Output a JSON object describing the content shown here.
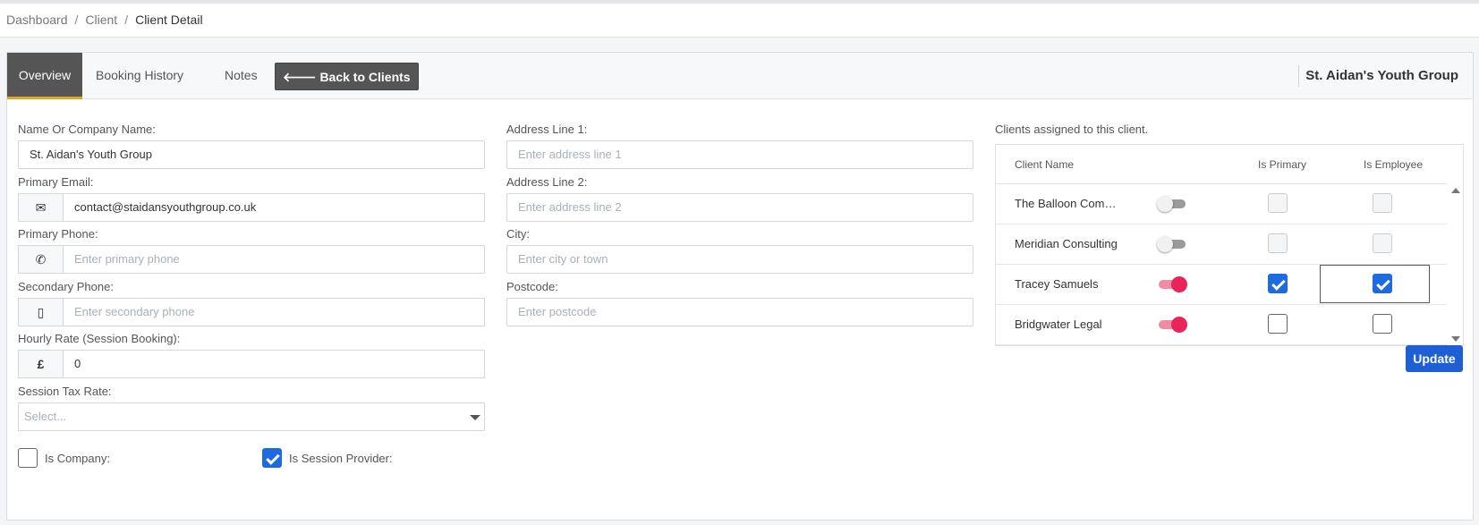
{
  "breadcrumb": {
    "items": [
      "Dashboard",
      "Client"
    ],
    "current": "Client Detail",
    "separator": "/"
  },
  "tabs": [
    {
      "label": "Overview",
      "active": true
    },
    {
      "label": "Booking History",
      "active": false
    },
    {
      "label": "Notes",
      "active": false
    }
  ],
  "back_button": {
    "icon": "arrow-left-icon",
    "label": "Back to Clients"
  },
  "client_title": "St. Aidan's Youth Group",
  "form": {
    "name": {
      "label": "Name Or Company Name:",
      "value": "St. Aidan's Youth Group"
    },
    "email": {
      "label": "Primary Email:",
      "icon": "envelope-icon",
      "value": "contact@staidansyouthgroup.co.uk"
    },
    "primary_phone": {
      "label": "Primary Phone:",
      "icon": "phone-icon",
      "placeholder": "Enter primary phone"
    },
    "secondary_phone": {
      "label": "Secondary Phone:",
      "icon": "mobile-icon",
      "placeholder": "Enter secondary phone"
    },
    "hourly_rate": {
      "label": "Hourly Rate (Session Booking):",
      "addon": "£",
      "value": "0"
    },
    "tax_rate": {
      "label": "Session Tax Rate:",
      "placeholder": "Select..."
    },
    "is_company": {
      "label": "Is Company:",
      "checked": false
    },
    "is_session_provider": {
      "label": "Is Session Provider:",
      "checked": true
    },
    "address1": {
      "label": "Address Line 1:",
      "placeholder": "Enter address line 1"
    },
    "address2": {
      "label": "Address Line 2:",
      "placeholder": "Enter address line 2"
    },
    "city": {
      "label": "City:",
      "placeholder": "Enter city or town"
    },
    "postcode": {
      "label": "Postcode:",
      "placeholder": "Enter postcode"
    }
  },
  "assigned": {
    "heading": "Clients assigned to this client.",
    "columns": [
      "Client Name",
      "Is Primary",
      "Is Employee"
    ],
    "rows": [
      {
        "name": "The Balloon Comp…",
        "enabled": false,
        "is_primary": false,
        "is_employee": false
      },
      {
        "name": "Meridian Consulting",
        "enabled": false,
        "is_primary": false,
        "is_employee": false
      },
      {
        "name": "Tracey Samuels",
        "enabled": true,
        "is_primary": true,
        "is_employee": true
      },
      {
        "name": "Bridgwater Legal",
        "enabled": true,
        "is_primary": false,
        "is_employee": false
      }
    ],
    "update_label": "Update"
  },
  "colors": {
    "accent_tab": "#e0a623",
    "primary_button": "#1e5fd6",
    "toggle_on": "#e8245b",
    "checkbox_checked": "#1e6ae0"
  }
}
